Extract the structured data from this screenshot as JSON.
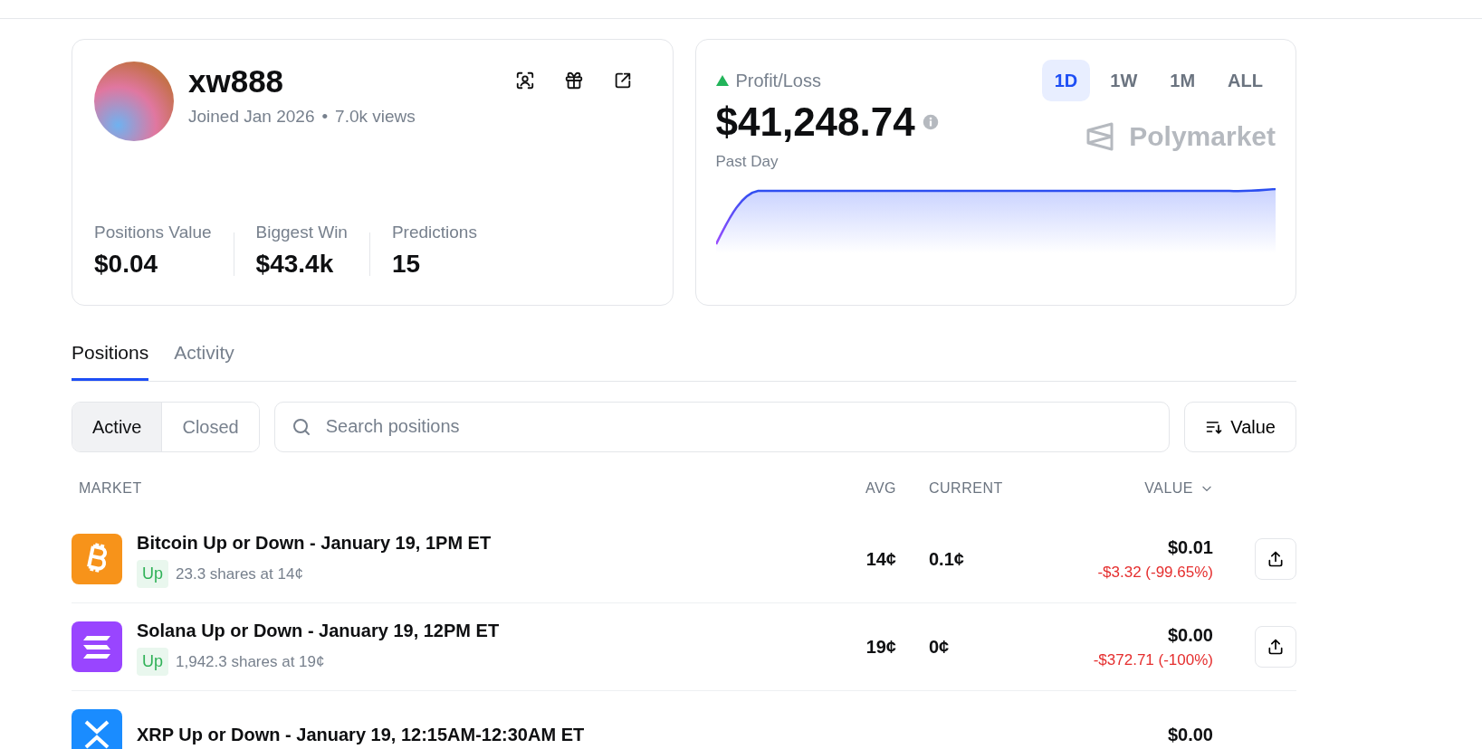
{
  "profile": {
    "username": "xw888",
    "joined": "Joined Jan 2026",
    "separator": "•",
    "views": "7.0k views",
    "stats": [
      {
        "label": "Positions Value",
        "value": "$0.04"
      },
      {
        "label": "Biggest Win",
        "value": "$43.4k"
      },
      {
        "label": "Predictions",
        "value": "15"
      }
    ]
  },
  "pnl": {
    "title": "Profit/Loss",
    "amount": "$41,248.74",
    "period": "Past Day",
    "brand": "Polymarket",
    "ranges": [
      {
        "label": "1D",
        "selected": true
      },
      {
        "label": "1W",
        "selected": false
      },
      {
        "label": "1M",
        "selected": false
      },
      {
        "label": "ALL",
        "selected": false
      }
    ]
  },
  "tabs": [
    {
      "label": "Positions",
      "selected": true
    },
    {
      "label": "Activity",
      "selected": false
    }
  ],
  "filters": [
    {
      "label": "Active",
      "selected": true
    },
    {
      "label": "Closed",
      "selected": false
    }
  ],
  "search": {
    "placeholder": "Search positions"
  },
  "sort_button": "Value",
  "table": {
    "columns": [
      "MARKET",
      "AVG",
      "CURRENT",
      "VALUE"
    ],
    "rows": [
      {
        "kind": "bitcoin",
        "title": "Bitcoin Up or Down - January 19, 1PM ET",
        "outcome": "Up",
        "shares": "23.3 shares at 14¢",
        "avg": "14¢",
        "current": "0.1¢",
        "value": "$0.01",
        "change": "-$3.32 (-99.65%)"
      },
      {
        "kind": "solana",
        "title": "Solana Up or Down - January 19, 12PM ET",
        "outcome": "Up",
        "shares": "1,942.3 shares at 19¢",
        "avg": "19¢",
        "current": "0¢",
        "value": "$0.00",
        "change": "-$372.71 (-100%)"
      },
      {
        "kind": "xrp",
        "title": "XRP Up or Down - January 19, 12:15AM-12:30AM ET",
        "value": "$0.00"
      }
    ]
  }
}
